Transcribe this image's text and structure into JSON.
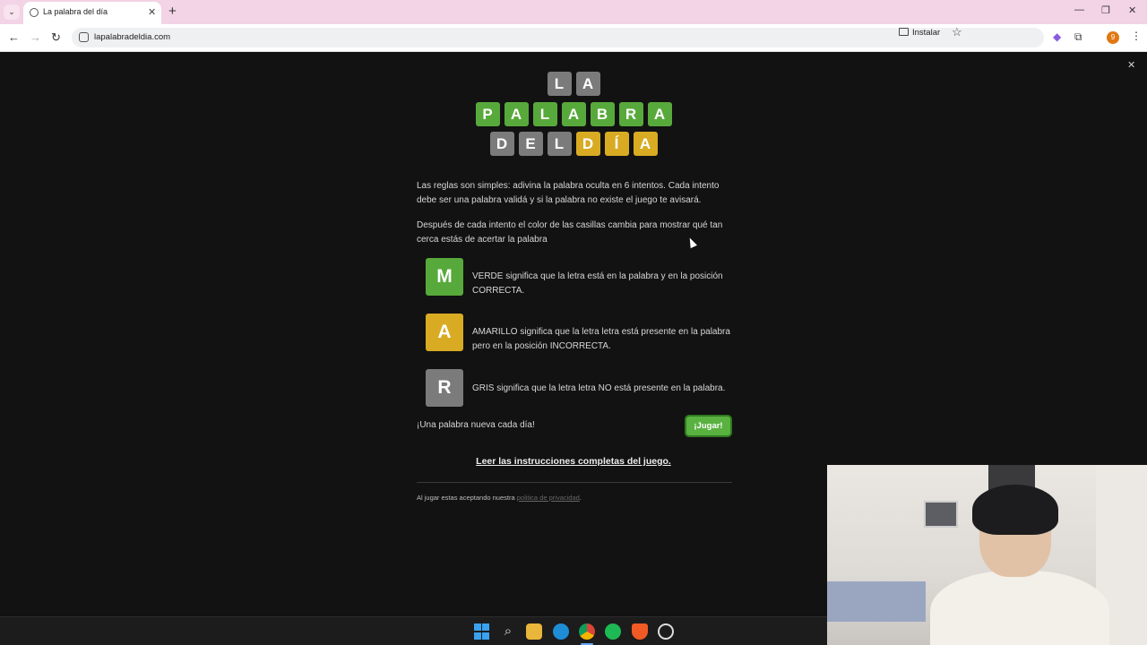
{
  "browser": {
    "tab_title": "La palabra del día",
    "url": "lapalabradeldia.com",
    "install_label": "Instalar",
    "profile_initial": "9"
  },
  "logo": {
    "rows": [
      {
        "tiles": [
          {
            "letter": "L",
            "color": "gray"
          },
          {
            "letter": "A",
            "color": "gray"
          }
        ]
      },
      {
        "tiles": [
          {
            "letter": "P",
            "color": "green"
          },
          {
            "letter": "A",
            "color": "green"
          },
          {
            "letter": "L",
            "color": "green"
          },
          {
            "letter": "A",
            "color": "green"
          },
          {
            "letter": "B",
            "color": "green"
          },
          {
            "letter": "R",
            "color": "green"
          },
          {
            "letter": "A",
            "color": "green"
          }
        ]
      },
      {
        "tiles": [
          {
            "letter": "D",
            "color": "gray"
          },
          {
            "letter": "E",
            "color": "gray"
          },
          {
            "letter": "L",
            "color": "gray"
          },
          {
            "letter": "D",
            "color": "yellow"
          },
          {
            "letter": "Í",
            "color": "yellow"
          },
          {
            "letter": "A",
            "color": "yellow"
          }
        ]
      }
    ]
  },
  "intro": {
    "p1": "Las reglas son simples: adivina la palabra oculta en 6 intentos. Cada intento debe ser una palabra validá y si la palabra no existe el juego te avisará.",
    "p2": "Después de cada intento el color de las casillas cambia para mostrar qué tan cerca estás de acertar la palabra"
  },
  "rules": [
    {
      "letter": "M",
      "color": "green",
      "text": "VERDE significa que la letra está en la palabra y en la posición CORRECTA."
    },
    {
      "letter": "A",
      "color": "yellow",
      "text": "AMARILLO significa que la letra letra está presente en la palabra pero en la posición INCORRECTA."
    },
    {
      "letter": "R",
      "color": "gray",
      "text": "GRIS significa que la letra letra NO está presente en la palabra."
    }
  ],
  "tagline": "¡Una palabra nueva cada día!",
  "play_button": "¡Jugar!",
  "instructions_link": "Leer las instrucciones completas del juego.",
  "privacy": {
    "prefix": "Al jugar estas aceptando nuestra ",
    "link": "politica de privacidad",
    "suffix": "."
  },
  "colors": {
    "green": "#58a93b",
    "yellow": "#d8ab23",
    "gray": "#7b7b7b",
    "background": "#121213"
  },
  "taskbar_icons": [
    "windows-start-icon",
    "search-icon",
    "file-explorer-icon",
    "edge-icon",
    "chrome-icon",
    "spotify-icon",
    "brave-icon",
    "obs-icon"
  ]
}
